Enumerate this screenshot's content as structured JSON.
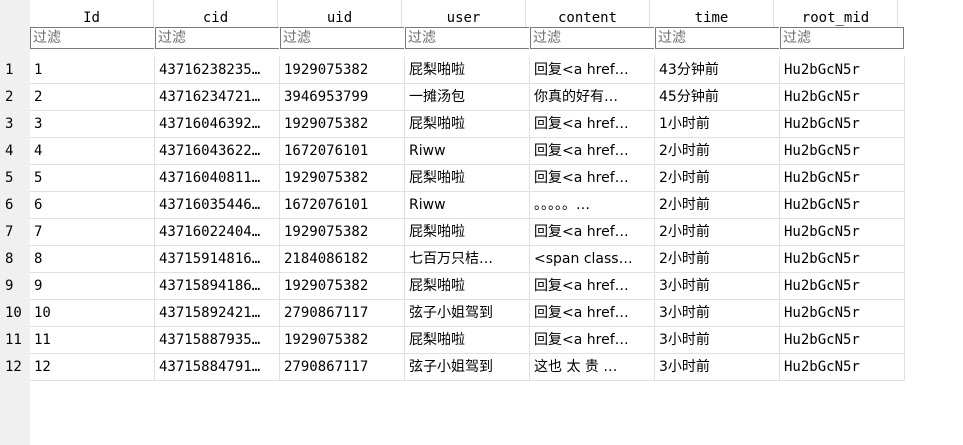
{
  "columns": [
    "Id",
    "cid",
    "uid",
    "user",
    "content",
    "time",
    "root_mid"
  ],
  "filter_placeholder": "过滤",
  "rows": [
    {
      "num": "1",
      "id": "1",
      "cid": "43716238235…",
      "uid": "1929075382",
      "user": "屁梨啪啦",
      "content": "回复<a href…",
      "time": "43分钟前",
      "root_mid": "Hu2bGcN5r"
    },
    {
      "num": "2",
      "id": "2",
      "cid": "43716234721…",
      "uid": "3946953799",
      "user": "一摊汤包",
      "content": "你真的好有…",
      "time": "45分钟前",
      "root_mid": "Hu2bGcN5r"
    },
    {
      "num": "3",
      "id": "3",
      "cid": "43716046392…",
      "uid": "1929075382",
      "user": "屁梨啪啦",
      "content": "回复<a href…",
      "time": "1小时前",
      "root_mid": "Hu2bGcN5r"
    },
    {
      "num": "4",
      "id": "4",
      "cid": "43716043622…",
      "uid": "1672076101",
      "user": "Riww",
      "content": "回复<a href…",
      "time": "2小时前",
      "root_mid": "Hu2bGcN5r"
    },
    {
      "num": "5",
      "id": "5",
      "cid": "43716040811…",
      "uid": "1929075382",
      "user": "屁梨啪啦",
      "content": "回复<a href…",
      "time": "2小时前",
      "root_mid": "Hu2bGcN5r"
    },
    {
      "num": "6",
      "id": "6",
      "cid": "43716035446…",
      "uid": "1672076101",
      "user": "Riww",
      "content": "。。。。。…",
      "time": "2小时前",
      "root_mid": "Hu2bGcN5r"
    },
    {
      "num": "7",
      "id": "7",
      "cid": "43716022404…",
      "uid": "1929075382",
      "user": "屁梨啪啦",
      "content": "回复<a href…",
      "time": "2小时前",
      "root_mid": "Hu2bGcN5r"
    },
    {
      "num": "8",
      "id": "8",
      "cid": "43715914816…",
      "uid": "2184086182",
      "user": "七百万只桔…",
      "content": "<span class…",
      "time": "2小时前",
      "root_mid": "Hu2bGcN5r"
    },
    {
      "num": "9",
      "id": "9",
      "cid": "43715894186…",
      "uid": "1929075382",
      "user": "屁梨啪啦",
      "content": "回复<a href…",
      "time": "3小时前",
      "root_mid": "Hu2bGcN5r"
    },
    {
      "num": "10",
      "id": "10",
      "cid": "43715892421…",
      "uid": "2790867117",
      "user": "弦子小姐驾到",
      "content": "回复<a href…",
      "time": "3小时前",
      "root_mid": "Hu2bGcN5r"
    },
    {
      "num": "11",
      "id": "11",
      "cid": "43715887935…",
      "uid": "1929075382",
      "user": "屁梨啪啦",
      "content": "回复<a href…",
      "time": "3小时前",
      "root_mid": "Hu2bGcN5r"
    },
    {
      "num": "12",
      "id": "12",
      "cid": "43715884791…",
      "uid": "2790867117",
      "user": "弦子小姐驾到",
      "content": "这也 太 贵 …",
      "time": "3小时前",
      "root_mid": "Hu2bGcN5r"
    }
  ]
}
